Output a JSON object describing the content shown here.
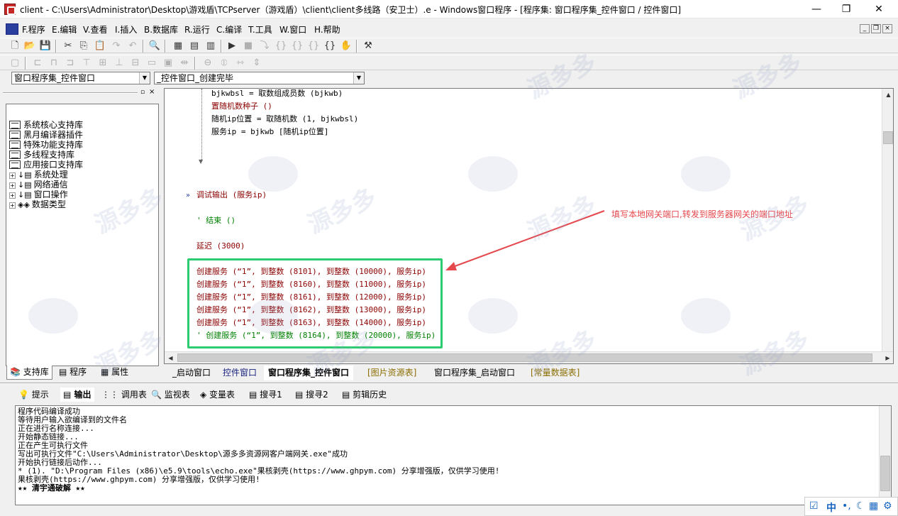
{
  "window": {
    "title": "client - C:\\Users\\Administrator\\Desktop\\游戏盾\\TCPserver（游戏盾）\\client\\client多线路（安卫士）.e - Windows窗口程序 - [程序集: 窗口程序集_控件窗口 / 控件窗口]",
    "minimize": "—",
    "maximize": "❐",
    "close": "✕"
  },
  "menu": {
    "items": [
      "F.程序",
      "E.编辑",
      "V.查看",
      "I.插入",
      "B.数据库",
      "R.运行",
      "C.编译",
      "T.工具",
      "W.窗口",
      "H.帮助"
    ]
  },
  "combos": {
    "assembly": "窗口程序集_控件窗口",
    "subroutine": "_控件窗口_创建完毕"
  },
  "tree": {
    "items": [
      "系统核心支持库",
      "黑月编译器插件",
      "特殊功能支持库",
      "多线程支持库",
      "应用接口支持库",
      "系统处理",
      "网络通信",
      "窗口操作",
      "数据类型"
    ]
  },
  "left_tabs": [
    "支持库",
    "程序",
    "属性"
  ],
  "code": {
    "l1": "bjkwbsl = 取数组成员数 (bjkwb)",
    "l2": "置随机数种子 ()",
    "l3": "随机ip位置 = 取随机数 (1, bjkwbsl)",
    "l4": "服务ip = bjkwb [随机ip位置]",
    "l5": "调试输出 (服务ip)",
    "l6": "' 结束 ()",
    "l7": "延迟 (3000)",
    "s1": "创建服务 (“1”, 到整数 (8101), 到整数 (10000), 服务ip)",
    "s2": "创建服务 (“1”, 到整数 (8160), 到整数 (11000), 服务ip)",
    "s3": "创建服务 (“1”, 到整数 (8161), 到整数 (12000), 服务ip)",
    "s4": "创建服务 (“1”, 到整数 (8162), 到整数 (13000), 服务ip)",
    "s5": "创建服务 (“1”, 到整数 (8163), 到整数 (14000), 服务ip)",
    "s6": "' 创建服务 (“1”, 到整数 (8164), 到整数 (20000), 服务ip)"
  },
  "annotation": {
    "text": "填写本地网关端口,转发到服务器网关的端口地址",
    "color": "#e5484d",
    "box_color": "#2ecc71"
  },
  "doc_tabs": [
    "_启动窗口",
    "控件窗口",
    "窗口程序集_控件窗口",
    "[图片资源表]",
    "窗口程序集_启动窗口",
    "[常量数据表]"
  ],
  "output_tabs": [
    "提示",
    "输出",
    "调用表",
    "监视表",
    "变量表",
    "搜寻1",
    "搜寻2",
    "剪辑历史"
  ],
  "output": {
    "lines": [
      "程序代码编译成功",
      "等待用户输入欲编译到的文件名",
      "正在进行名称连接...",
      "开始静态链接...",
      "正在产生可执行文件",
      "写出可执行文件\"C:\\Users\\Administrator\\Desktop\\源多多资源网客户端网关.exe\"成功",
      "开始执行链接后动作...",
      "* (1). \"D:\\Program Files (x86)\\e5.9\\tools\\echo.exe\"果核剥壳(https://www.ghpym.com) 分享增强版，仅供学习使用!",
      "果核剥壳(https://www.ghpym.com) 分享增强版，仅供学习使用!",
      "★★ 清宇通破解 ★★"
    ]
  },
  "tray": {
    "ime": "中"
  },
  "watermark": {
    "text": "源多多"
  }
}
